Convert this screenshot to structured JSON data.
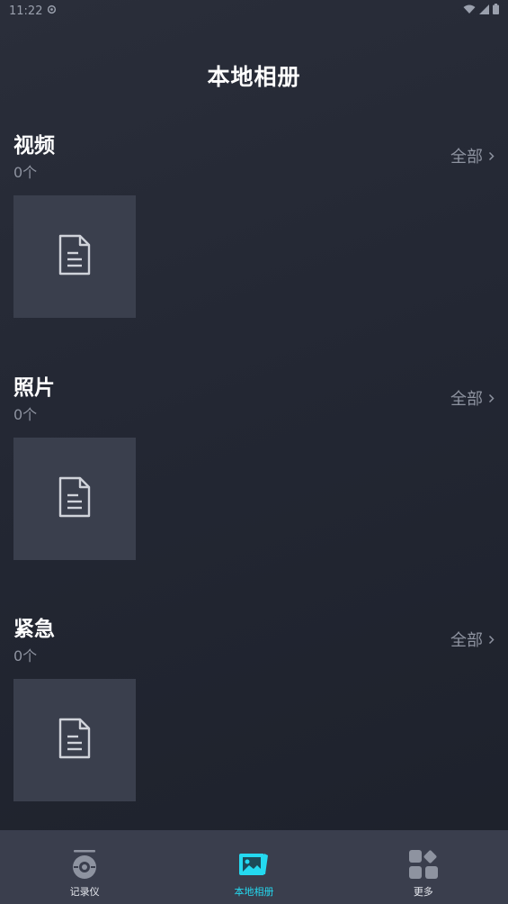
{
  "status": {
    "time": "11:22"
  },
  "header": {
    "title": "本地相册"
  },
  "sections": [
    {
      "name": "视频",
      "count": "0个",
      "all_label": "全部"
    },
    {
      "name": "照片",
      "count": "0个",
      "all_label": "全部"
    },
    {
      "name": "紧急",
      "count": "0个",
      "all_label": "全部"
    }
  ],
  "tabs": [
    {
      "label": "记录仪",
      "icon": "dashcam-icon"
    },
    {
      "label": "本地相册",
      "icon": "album-icon",
      "active": true
    },
    {
      "label": "更多",
      "icon": "grid-icon"
    }
  ],
  "colors": {
    "accent": "#24d9f0",
    "thumb_bg": "#3a3f4d",
    "tabbar_bg": "#3a3e4d"
  }
}
